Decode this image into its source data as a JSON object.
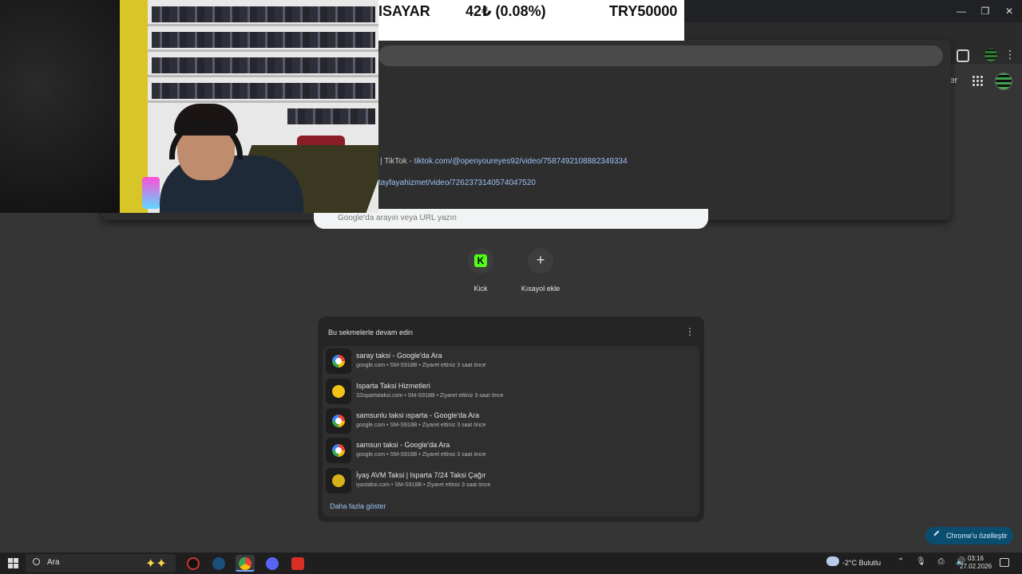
{
  "window": {
    "minimize": "—",
    "restore": "❐",
    "close": "✕"
  },
  "toolbar": {
    "menu_glyph": "⋮"
  },
  "header": {
    "gmail_partial": "ler"
  },
  "ticker": {
    "left": "ISAYAR",
    "mid": "42₺ (0.08%)",
    "right": "TRY50000"
  },
  "suggestions": [
    {
      "prefix": "| TikTok  -  ",
      "url": "tiktok.com/@openyoureyes92/video/7587492108882349334"
    },
    {
      "prefix": "",
      "url": "tayfayahizmet/video/7262373140574047520"
    }
  ],
  "search": {
    "placeholder": "Google'da arayın veya URL yazın"
  },
  "shortcuts": [
    {
      "label": "Kick",
      "glyph": "K"
    },
    {
      "label": "Kısayol ekle",
      "glyph": "+"
    }
  ],
  "continue": {
    "title": "Bu sekmelerle devam edin",
    "menu_glyph": "⋮",
    "tabs": [
      {
        "title": "saray taksi - Google'da Ara",
        "meta": "google.com • SM-S918B • Ziyaret ettiniz 3 saat önce"
      },
      {
        "title": "Isparta Taksi Hizmetleri",
        "meta": "32ispartataksi.com • SM-S918B • Ziyaret ettiniz 3 saat önce"
      },
      {
        "title": "samsunlu taksi ısparta - Google'da Ara",
        "meta": "google.com • SM-S918B • Ziyaret ettiniz 3 saat önce"
      },
      {
        "title": "samsun taksi - Google'da Ara",
        "meta": "google.com • SM-S918B • Ziyaret ettiniz 3 saat önce"
      },
      {
        "title": "İyaş AVM Taksi | Isparta 7/24 Taksi Çağır",
        "meta": "iyastaksi.com • SM-S918B • Ziyaret ettiniz 3 saat önce"
      }
    ],
    "show_more": "Daha fazla göster"
  },
  "customize": {
    "label": "Chrome'u özelleştir"
  },
  "taskbar": {
    "search_label": "Ara",
    "sparkle": "✦✦",
    "weather": "-2°C  Bulutlu",
    "tray": "⌃ 🎙 ⎙ 🔊",
    "time": "03:16",
    "date": "27.02.2026"
  }
}
